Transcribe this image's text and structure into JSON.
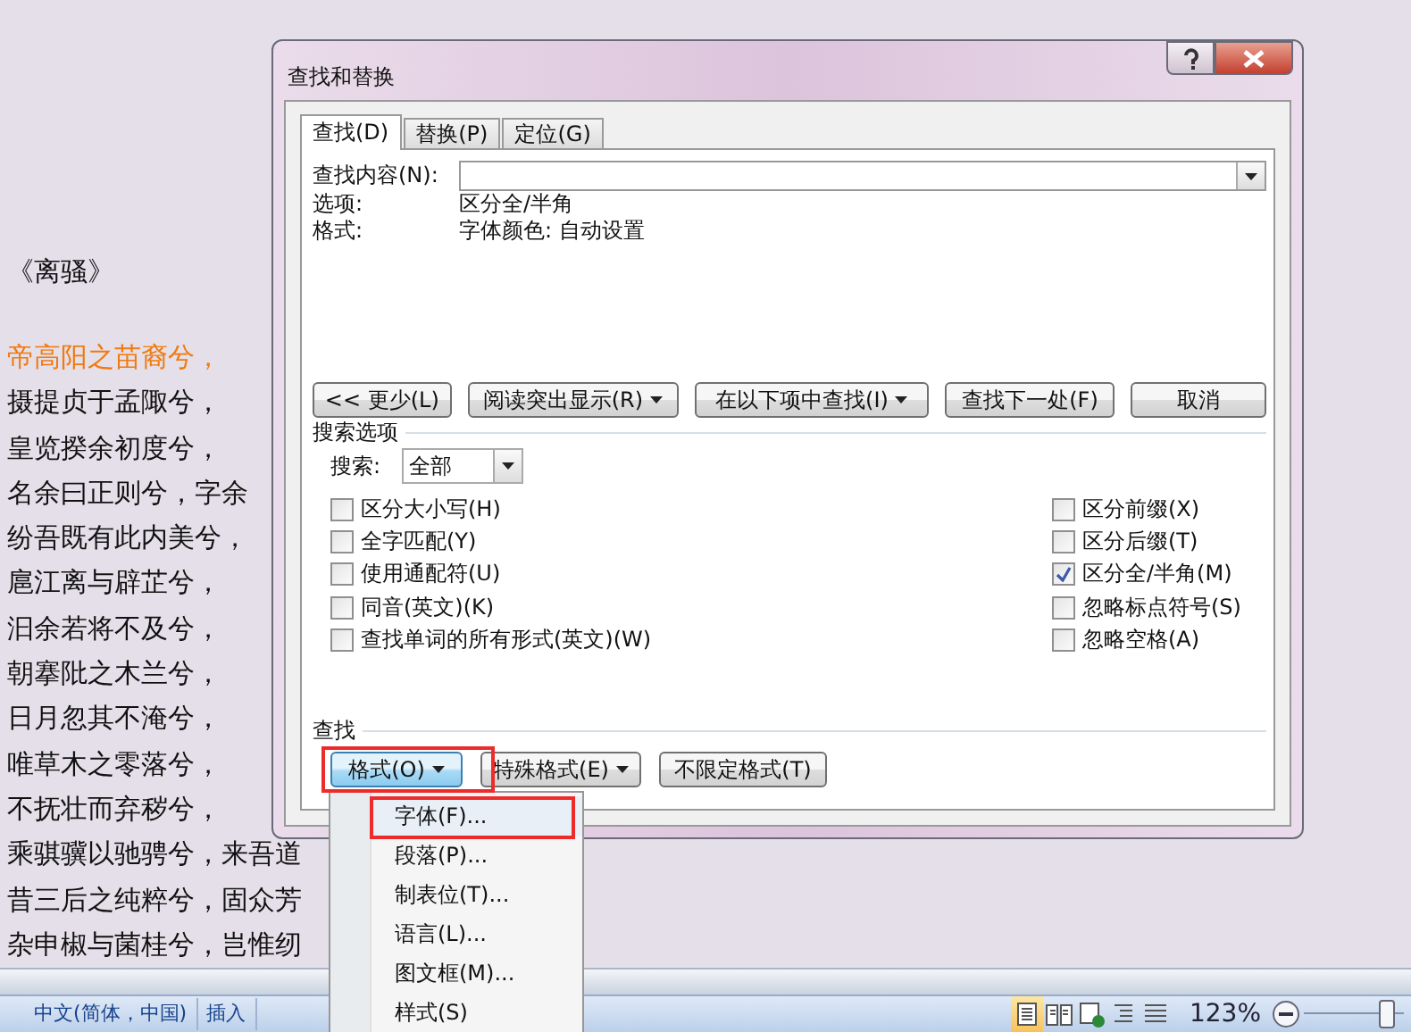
{
  "document": {
    "title": "《离骚》",
    "lines": [
      {
        "text": "帝高阳之苗裔兮，",
        "highlighted": true
      },
      {
        "text": "摄提贞于孟陬兮，",
        "highlighted": false
      },
      {
        "text": "皇览揆余初度兮，",
        "highlighted": false
      },
      {
        "text": "名余曰正则兮，字余",
        "highlighted": false
      },
      {
        "text": "纷吾既有此内美兮，",
        "highlighted": false
      },
      {
        "text": "扈江离与辟芷兮，",
        "highlighted": false
      },
      {
        "text": "汩余若将不及兮，",
        "highlighted": false
      },
      {
        "text": "朝搴阰之木兰兮，",
        "highlighted": false
      },
      {
        "text": "日月忽其不淹兮，",
        "highlighted": false
      },
      {
        "text": "唯草木之零落兮，",
        "highlighted": false
      },
      {
        "text": "不抚壮而弃秽兮，",
        "highlighted": false
      },
      {
        "text": "乘骐骥以驰骋兮，来吾道",
        "highlighted": false
      },
      {
        "text": "昔三后之纯粹兮，固众芳",
        "highlighted": false
      },
      {
        "text": "杂申椒与菌桂兮，岂惟纫",
        "highlighted": false
      }
    ]
  },
  "dialog": {
    "title": "查找和替换",
    "tabs": [
      {
        "label": "查找(D)",
        "selected": true
      },
      {
        "label": "替换(P)",
        "selected": false
      },
      {
        "label": "定位(G)",
        "selected": false
      }
    ],
    "find_what_label": "查找内容(N):",
    "options_label": "选项:",
    "options_value": "区分全/半角",
    "format_label": "格式:",
    "format_value": "字体颜色: 自动设置",
    "action_buttons": [
      {
        "label": "<< 更少(L)",
        "dropdown": false
      },
      {
        "label": "阅读突出显示(R)",
        "dropdown": true
      },
      {
        "label": "在以下项中查找(I)",
        "dropdown": true
      },
      {
        "label": "查找下一处(F)",
        "dropdown": false
      },
      {
        "label": "取消",
        "dropdown": false
      }
    ],
    "search_options": {
      "title": "搜索选项",
      "search_label": "搜索:",
      "search_value": "全部",
      "left_checkboxes": [
        {
          "label": "区分大小写(H)",
          "checked": false
        },
        {
          "label": "全字匹配(Y)",
          "checked": false
        },
        {
          "label": "使用通配符(U)",
          "checked": false
        },
        {
          "label": "同音(英文)(K)",
          "checked": false
        },
        {
          "label": "查找单词的所有形式(英文)(W)",
          "checked": false
        }
      ],
      "right_checkboxes": [
        {
          "label": "区分前缀(X)",
          "checked": false
        },
        {
          "label": "区分后缀(T)",
          "checked": false
        },
        {
          "label": "区分全/半角(M)",
          "checked": true
        },
        {
          "label": "忽略标点符号(S)",
          "checked": false
        },
        {
          "label": "忽略空格(A)",
          "checked": false
        }
      ]
    },
    "find_section": {
      "title": "查找",
      "buttons": [
        {
          "label": "格式(O)",
          "dropdown": true,
          "pressed": true
        },
        {
          "label": "特殊格式(E)",
          "dropdown": true,
          "pressed": false
        },
        {
          "label": "不限定格式(T)",
          "dropdown": false,
          "pressed": false
        }
      ]
    }
  },
  "format_menu": {
    "items": [
      {
        "label": "字体(F)...",
        "selected": true
      },
      {
        "label": "段落(P)...",
        "selected": false
      },
      {
        "label": "制表位(T)...",
        "selected": false
      },
      {
        "label": "语言(L)...",
        "selected": false
      },
      {
        "label": "图文框(M)...",
        "selected": false
      },
      {
        "label": "样式(S)",
        "selected": false
      }
    ]
  },
  "status_bar": {
    "language": "中文(简体，中国)",
    "mode": "插入",
    "views": [
      {
        "selected": true
      },
      {
        "selected": false
      },
      {
        "selected": false
      },
      {
        "selected": false
      },
      {
        "selected": false
      }
    ],
    "zoom": "123%",
    "zoom_slider": {
      "level": 0.9
    }
  }
}
